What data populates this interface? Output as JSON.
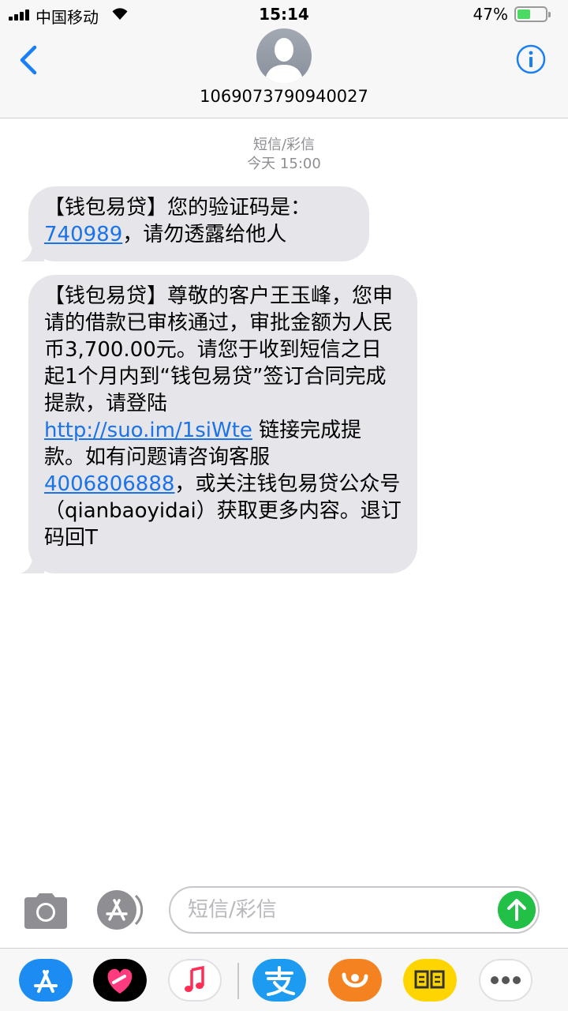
{
  "status_bar": {
    "carrier": "中国移动",
    "time": "15:14",
    "battery_percent": "47%",
    "battery_level": 0.47
  },
  "header": {
    "contact_number": "1069073790940027",
    "icons": {
      "back": "chevron-left-icon",
      "avatar": "person-silhouette-icon",
      "info": "info-icon"
    }
  },
  "conversation": {
    "service_label": "短信/彩信",
    "timestamp": "今天 15:00",
    "messages": [
      {
        "parts": [
          "【钱包易贷】您的验证码是：",
          "740989",
          "，请勿透露给他人"
        ]
      },
      {
        "parts": [
          "【钱包易贷】尊敬的客户王玉峰，您申请的借款已审核通过，审批金额为人民币3,700.00元。请您于收到短信之日起1个月内到“钱包易贷”签订合同完成提款，请登陆",
          "http://suo.im/1siWte",
          " 链接完成提款。如有问题请咨询客服",
          "4006806888",
          "，或关注钱包易贷公众号（qianbaoyidai）获取更多内容。退订码回T"
        ]
      }
    ]
  },
  "compose": {
    "placeholder": "短信/彩信",
    "icons": {
      "camera": "camera-icon",
      "app_store": "app-store-icon",
      "send": "send-arrow-icon"
    }
  },
  "app_drawer": {
    "apps": [
      "app-store-icon",
      "digital-touch-icon",
      "music-icon",
      "alipay-icon",
      "uc-browser-icon",
      "xianyu-icon",
      "more-icon"
    ]
  },
  "colors": {
    "bubble": "#e5e5ea",
    "link": "#1a73e8",
    "accent": "#1a7ef5",
    "send": "#22c046",
    "battery": "#4cd964"
  }
}
